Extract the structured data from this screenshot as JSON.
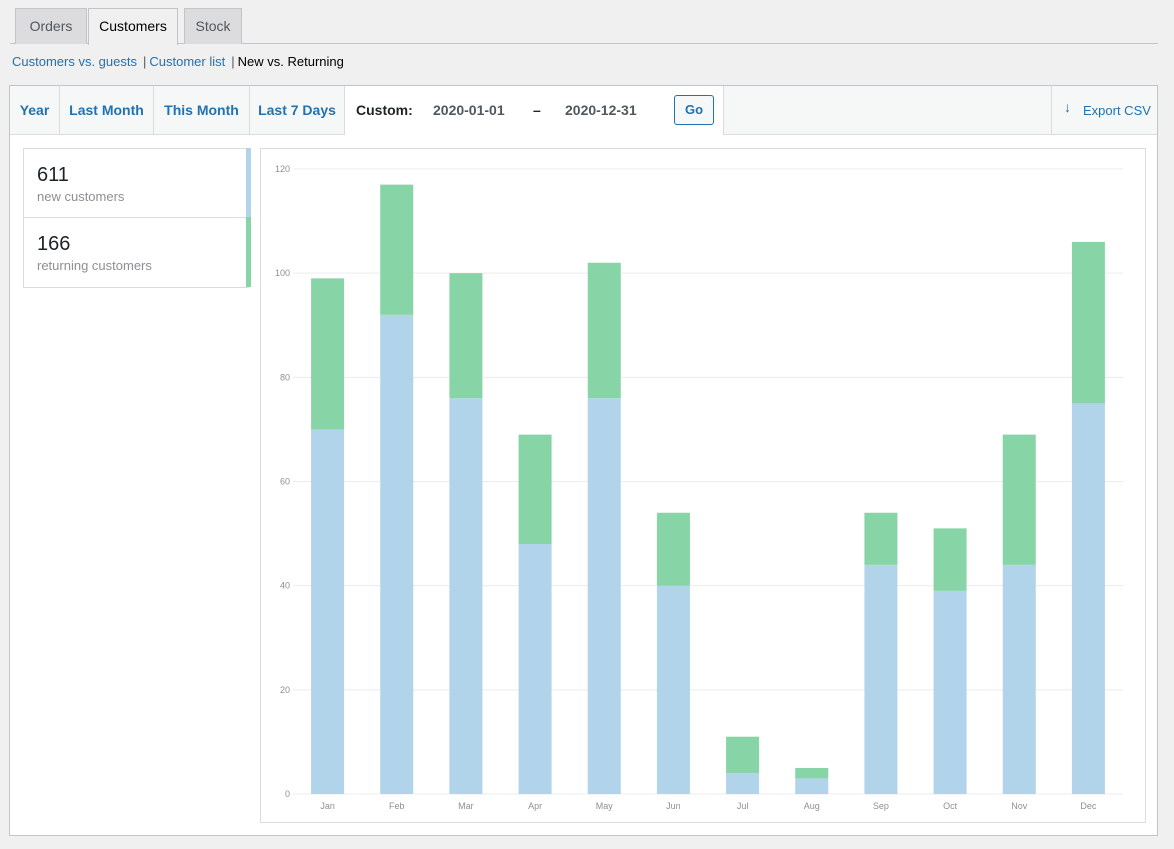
{
  "tabs": [
    {
      "label": "Orders",
      "active": false
    },
    {
      "label": "Customers",
      "active": true
    },
    {
      "label": "Stock",
      "active": false
    }
  ],
  "subnav": {
    "links": [
      "Customers vs. guests",
      "Customer list"
    ],
    "current": "New vs. Returning"
  },
  "ranges": [
    "Year",
    "Last Month",
    "This Month",
    "Last 7 Days"
  ],
  "custom": {
    "label": "Custom:",
    "start": "2020-01-01",
    "separator": "–",
    "end": "2020-12-31",
    "go_label": "Go"
  },
  "export": {
    "label": "Export CSV",
    "icon": "arrow-down-icon"
  },
  "legend": [
    {
      "value": "611",
      "label": "new customers",
      "color": "#b1d4ea"
    },
    {
      "value": "166",
      "label": "returning customers",
      "color": "#87d4a6"
    }
  ],
  "chart_data": {
    "type": "bar",
    "stacked": true,
    "categories": [
      "Jan",
      "Feb",
      "Mar",
      "Apr",
      "May",
      "Jun",
      "Jul",
      "Aug",
      "Sep",
      "Oct",
      "Nov",
      "Dec"
    ],
    "series": [
      {
        "color": "#b1d4ea",
        "values": [
          70,
          92,
          76,
          48,
          76,
          40,
          4,
          3,
          44,
          39,
          44,
          75
        ]
      },
      {
        "color": "#87d4a6",
        "values": [
          29,
          25,
          24,
          21,
          26,
          14,
          7,
          2,
          10,
          12,
          25,
          31
        ]
      }
    ],
    "ylim": [
      0,
      120
    ],
    "yticks": [
      "0",
      "20",
      "40",
      "60",
      "80",
      "100",
      "120"
    ],
    "grid": true
  }
}
